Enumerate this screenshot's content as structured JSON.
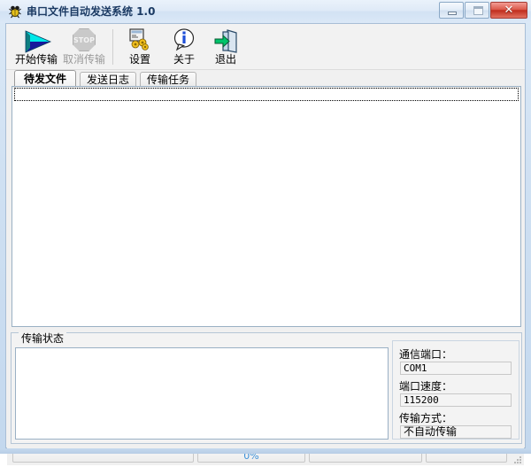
{
  "window": {
    "title": "串口文件自动发送系统 1.0",
    "icon": "app-bug-icon",
    "buttons": {
      "minimize": "minimize-icon",
      "maximize": "maximize-icon",
      "close": "✕"
    }
  },
  "toolbar": {
    "items": [
      {
        "label": "开始传输",
        "icon": "play-icon",
        "enabled": true
      },
      {
        "label": "取消传输",
        "icon": "stop-icon",
        "enabled": false
      },
      {
        "label": "设置",
        "icon": "settings-gears-icon",
        "enabled": true
      },
      {
        "label": "关于",
        "icon": "info-balloon-icon",
        "enabled": true
      },
      {
        "label": "退出",
        "icon": "exit-door-icon",
        "enabled": true
      }
    ],
    "stop_glyph": "STOP"
  },
  "tabs": [
    {
      "label": "待发文件",
      "active": true
    },
    {
      "label": "发送日志",
      "active": false
    },
    {
      "label": "传输任务",
      "active": false
    }
  ],
  "file_list": {
    "rows": [],
    "empty_text": ""
  },
  "status_group": {
    "title": "传输状态",
    "log_text": ""
  },
  "settings_panel": {
    "fields": [
      {
        "label": "通信端口：",
        "value": "COM1"
      },
      {
        "label": "端口速度：",
        "value": "115200"
      },
      {
        "label": "传输方式：",
        "value": "不自动传输"
      }
    ]
  },
  "statusbar": {
    "panels": [
      {
        "text": "",
        "accent": false
      },
      {
        "text": "0%",
        "accent": true
      },
      {
        "text": "",
        "accent": false
      },
      {
        "text": "",
        "accent": false
      }
    ]
  },
  "colors": {
    "accent_blue": "#3a8fd8",
    "frame_blue": "#c3d8ee",
    "title_text": "#1b3a63",
    "close_red": "#c02d1d"
  }
}
